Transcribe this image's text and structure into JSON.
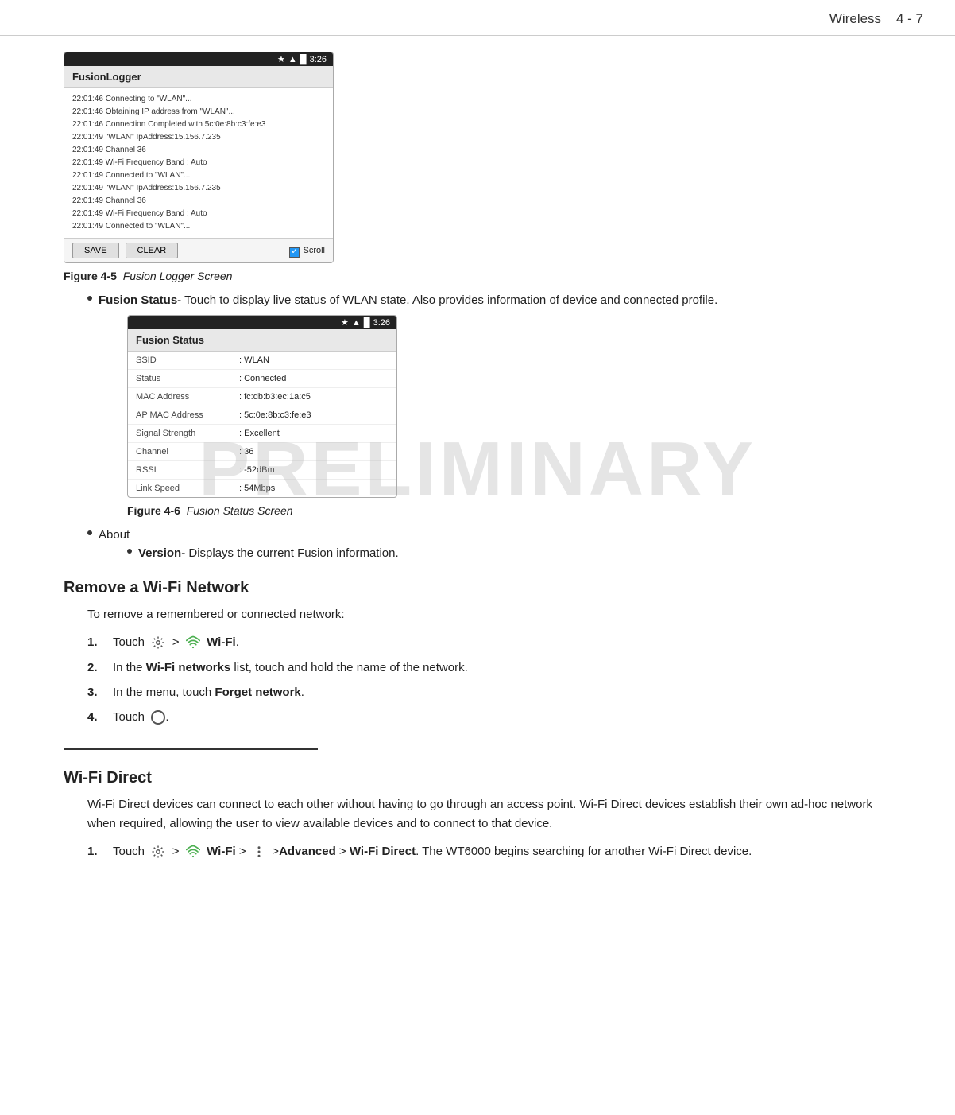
{
  "header": {
    "title": "Wireless",
    "page": "4 - 7"
  },
  "figure5": {
    "label": "Figure 4-5",
    "caption": "Fusion Logger Screen",
    "statusbar_time": "3:26",
    "screen_title": "FusionLogger",
    "log_lines": [
      "22:01:46 Connecting to \"WLAN\"...",
      "22:01:46 Obtaining IP address from \"WLAN\"...",
      "22:01:46 Connection Completed with 5c:0e:8b:c3:fe:e3",
      "22:01:49 \"WLAN\" IpAddress:15.156.7.235",
      "22:01:49 Channel 36",
      "22:01:49 Wi-Fi Frequency Band : Auto",
      "22:01:49 Connected to \"WLAN\"...",
      "22:01:49 \"WLAN\" IpAddress:15.156.7.235",
      "22:01:49 Channel 36",
      "22:01:49 Wi-Fi Frequency Band : Auto",
      "22:01:49 Connected to \"WLAN\"..."
    ],
    "btn_save": "SAVE",
    "btn_clear": "CLEAR",
    "scroll_label": "Scroll"
  },
  "fusion_status_bullet": {
    "title": "Fusion Status",
    "description": "- Touch to display live status of WLAN state. Also provides information of device and connected profile."
  },
  "figure6": {
    "label": "Figure 4-6",
    "caption": "Fusion Status Screen",
    "statusbar_time": "3:26",
    "screen_title": "Fusion Status",
    "rows": [
      {
        "key": "SSID",
        "value": ": WLAN"
      },
      {
        "key": "Status",
        "value": ": Connected"
      },
      {
        "key": "MAC Address",
        "value": ": fc:db:b3:ec:1a:c5"
      },
      {
        "key": "AP MAC Address",
        "value": ": 5c:0e:8b:c3:fe:e3"
      },
      {
        "key": "Signal Strength",
        "value": ": Excellent"
      },
      {
        "key": "Channel",
        "value": ": 36"
      },
      {
        "key": "RSSI",
        "value": ": -52dBm"
      },
      {
        "key": "Link Speed",
        "value": ": 54Mbps"
      }
    ]
  },
  "about_bullet": {
    "title": "About",
    "version_title": "Version",
    "version_desc": "- Displays the current Fusion information."
  },
  "remove_wifi": {
    "section_title": "Remove a Wi-Fi Network",
    "intro": "To remove a remembered or connected network:",
    "steps": [
      {
        "num": "1.",
        "text_before": "Touch",
        "icon_gear": true,
        "text_mid": ">",
        "icon_wifi": true,
        "text_after": "Wi-Fi."
      },
      {
        "num": "2.",
        "text": "In the ",
        "bold": "Wi-Fi networks",
        "text2": " list, touch and hold the name of the network."
      },
      {
        "num": "3.",
        "text": "In the menu, touch ",
        "bold": "Forget network",
        "text2": "."
      },
      {
        "num": "4.",
        "text_before": "Touch",
        "icon_home": true,
        "text_after": "."
      }
    ]
  },
  "wifi_direct": {
    "section_title": "Wi-Fi Direct",
    "body": "Wi-Fi Direct devices can connect to each other without having to go through an access point. Wi-Fi Direct devices establish their own ad-hoc network when required, allowing the user to view available devices and to connect to that device.",
    "step1_num": "1.",
    "step1_text_before": "Touch",
    "step1_icon_gear": true,
    "step1_text_mid": ">",
    "step1_icon_wifi": true,
    "step1_text_mid2": "Wi-Fi >",
    "step1_icon_menu": true,
    "step1_text_end": ">Advanced > Wi-Fi Direct. The WT6000 begins searching for another Wi-Fi Direct device."
  }
}
